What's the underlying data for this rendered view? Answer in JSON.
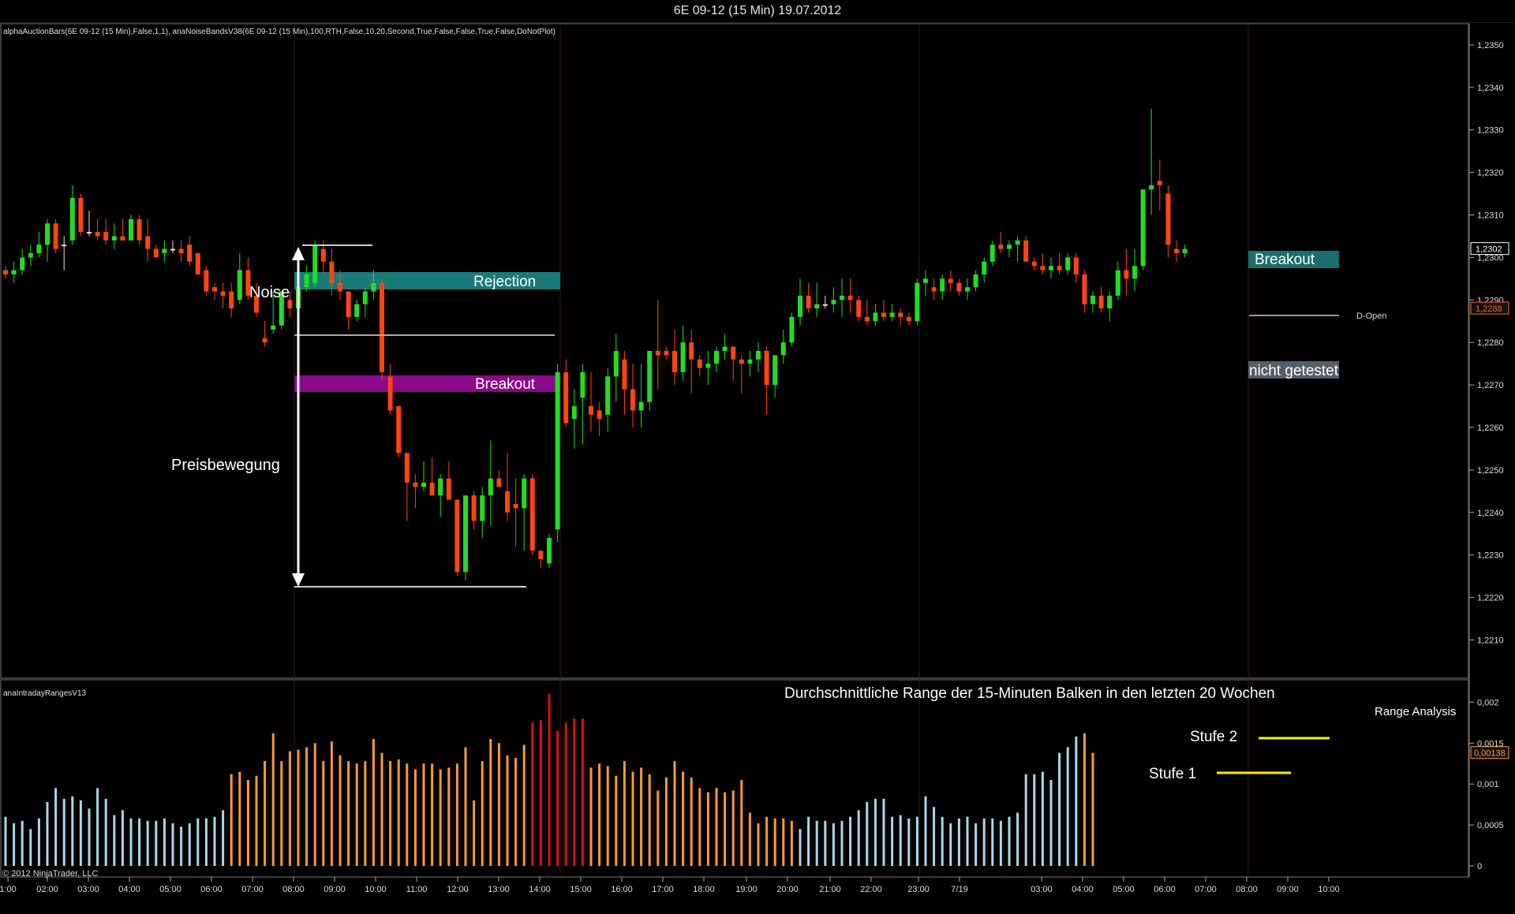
{
  "window": {
    "title": "6E 09-12 (15 Min)  19.07.2012"
  },
  "indicator_text": "alphaAuctionBars(6E 09-12 (15 Min),False,1,1), anaNoiseBandsV38(6E 09-12 (15 Min),100,RTH,False,10,20,Second,True,False,False,True,False,DoNotPlot)",
  "lower_panel_label": "anaIntradayRangesV13",
  "copyright": "© 2012 NinjaTrader, LLC",
  "annotations": {
    "noise": "Noise",
    "rejection": "Rejection",
    "breakout1": "Breakout",
    "preisbewegung": "Preisbewegung",
    "breakout2": "Breakout",
    "nicht_getestet": "nicht getestet",
    "d_open": "D-Open",
    "range_title": "Durchschnittliche Range der 15-Minuten Balken in den letzten 20 Wochen",
    "range_analysis": "Range Analysis",
    "stufe1": "Stufe 1",
    "stufe2": "Stufe 2"
  },
  "colors": {
    "up": "#22dd22",
    "down": "#ff4411",
    "neutral": "#ffddcc",
    "rejection_band": "#1a7a7a",
    "breakout_band": "#8a0a8a",
    "range_low": "#a8d8e8",
    "range_mid": "#ff9933",
    "range_high": "#dd1111",
    "stufe_line": "#ffee00",
    "breakout2_box": "#1a6e6e",
    "nicht_box": "#555e66"
  },
  "chart_data": [
    {
      "type": "candlestick",
      "title": "6E 09-12 (15 Min)  19.07.2012",
      "price_ticks": [
        "1,2350",
        "1,2340",
        "1,2330",
        "1,2320",
        "1,2310",
        "1,2300",
        "1,2290",
        "1,2280",
        "1,2270",
        "1,2260",
        "1,2250",
        "1,2240",
        "1,2230",
        "1,2220",
        "1,2210"
      ],
      "ylim": [
        1.2201,
        1.2355
      ],
      "price_labels": [
        {
          "value": 1.2302,
          "text": "1,2302"
        },
        {
          "value": 1.2288,
          "text": "1,2288"
        }
      ],
      "time_ticks": [
        "1:00",
        "02:00",
        "03:00",
        "04:00",
        "05:00",
        "06:00",
        "07:00",
        "08:00",
        "09:00",
        "10:00",
        "11:00",
        "12:00",
        "13:00",
        "14:00",
        "15:00",
        "16:00",
        "17:00",
        "18:00",
        "19:00",
        "20:00",
        "21:00",
        "22:00",
        "23:00",
        "7/19",
        "03:00",
        "04:00",
        "05:00",
        "06:00",
        "07:00",
        "08:00",
        "09:00",
        "10:00"
      ],
      "candles": [
        [
          1.2297,
          1.2298,
          1.2295,
          1.2296
        ],
        [
          1.2296,
          1.2299,
          1.2294,
          1.2297
        ],
        [
          1.2297,
          1.2302,
          1.2296,
          1.23
        ],
        [
          1.23,
          1.2303,
          1.2298,
          1.2301
        ],
        [
          1.2301,
          1.2306,
          1.23,
          1.2303
        ],
        [
          1.2303,
          1.2309,
          1.2299,
          1.2308
        ],
        [
          1.2308,
          1.2309,
          1.2301,
          1.2302
        ],
        [
          1.2303,
          1.2305,
          1.2297,
          1.2303
        ],
        [
          1.2304,
          1.2317,
          1.2303,
          1.2314
        ],
        [
          1.2314,
          1.2315,
          1.2305,
          1.2306
        ],
        [
          1.2306,
          1.2311,
          1.2305,
          1.2306
        ],
        [
          1.2306,
          1.2309,
          1.2304,
          1.2305
        ],
        [
          1.2306,
          1.2309,
          1.2303,
          1.2304
        ],
        [
          1.2304,
          1.2308,
          1.2302,
          1.2305
        ],
        [
          1.2305,
          1.2309,
          1.2304,
          1.2304
        ],
        [
          1.2304,
          1.231,
          1.2304,
          1.2309
        ],
        [
          1.2309,
          1.231,
          1.2303,
          1.2304
        ],
        [
          1.2305,
          1.2309,
          1.2299,
          1.2302
        ],
        [
          1.2302,
          1.2303,
          1.23,
          1.23
        ],
        [
          1.2301,
          1.2304,
          1.2299,
          1.2302
        ],
        [
          1.2302,
          1.2304,
          1.2301,
          1.2302
        ],
        [
          1.2302,
          1.2304,
          1.2299,
          1.2301
        ],
        [
          1.2303,
          1.2305,
          1.2298,
          1.2299
        ],
        [
          1.2301,
          1.2301,
          1.2296,
          1.2296
        ],
        [
          1.2297,
          1.2298,
          1.2291,
          1.2292
        ],
        [
          1.2293,
          1.2294,
          1.229,
          1.2292
        ],
        [
          1.2292,
          1.2294,
          1.2288,
          1.2291
        ],
        [
          1.2292,
          1.2294,
          1.2286,
          1.2288
        ],
        [
          1.229,
          1.2301,
          1.2289,
          1.2297
        ],
        [
          1.2297,
          1.23,
          1.229,
          1.2291
        ],
        [
          1.2291,
          1.2294,
          1.2286,
          1.2287
        ],
        [
          1.2281,
          1.2285,
          1.2279,
          1.228
        ],
        [
          1.2283,
          1.2292,
          1.2282,
          1.2284
        ],
        [
          1.2284,
          1.2292,
          1.2283,
          1.2292
        ],
        [
          1.229,
          1.2292,
          1.2286,
          1.2288
        ],
        [
          1.2288,
          1.2294,
          1.2287,
          1.2293
        ],
        [
          1.2293,
          1.2298,
          1.2292,
          1.2296
        ],
        [
          1.2294,
          1.2304,
          1.2293,
          1.2303
        ],
        [
          1.2302,
          1.2304,
          1.2296,
          1.2299
        ],
        [
          1.2299,
          1.2302,
          1.2291,
          1.2294
        ],
        [
          1.2294,
          1.2297,
          1.229,
          1.2292
        ],
        [
          1.2292,
          1.2292,
          1.2283,
          1.2286
        ],
        [
          1.2286,
          1.229,
          1.2285,
          1.2289
        ],
        [
          1.2289,
          1.2293,
          1.2286,
          1.2292
        ],
        [
          1.2292,
          1.2297,
          1.229,
          1.2294
        ],
        [
          1.2294,
          1.2295,
          1.2271,
          1.2273
        ],
        [
          1.2272,
          1.2275,
          1.2263,
          1.2264
        ],
        [
          1.2265,
          1.2265,
          1.2253,
          1.2254
        ],
        [
          1.2254,
          1.2253,
          1.2238,
          1.2247
        ],
        [
          1.2247,
          1.2249,
          1.2241,
          1.2246
        ],
        [
          1.2246,
          1.2252,
          1.2245,
          1.2247
        ],
        [
          1.2247,
          1.2253,
          1.2244,
          1.2244
        ],
        [
          1.2244,
          1.2249,
          1.2239,
          1.2248
        ],
        [
          1.2248,
          1.2252,
          1.2244,
          1.2243
        ],
        [
          1.2243,
          1.2243,
          1.2225,
          1.2226
        ],
        [
          1.2226,
          1.2244,
          1.2224,
          1.2244
        ],
        [
          1.2244,
          1.2245,
          1.2236,
          1.2238
        ],
        [
          1.2238,
          1.2246,
          1.2234,
          1.2244
        ],
        [
          1.2244,
          1.2257,
          1.2237,
          1.2248
        ],
        [
          1.2248,
          1.225,
          1.2246,
          1.2246
        ],
        [
          1.2245,
          1.2254,
          1.2238,
          1.224
        ],
        [
          1.2242,
          1.2248,
          1.2232,
          1.2241
        ],
        [
          1.2241,
          1.2249,
          1.2231,
          1.2248
        ],
        [
          1.2248,
          1.2249,
          1.223,
          1.2231
        ],
        [
          1.2231,
          1.2231,
          1.2227,
          1.2229
        ],
        [
          1.2228,
          1.2235,
          1.2227,
          1.2234
        ],
        [
          1.2236,
          1.2275,
          1.2233,
          1.2273
        ],
        [
          1.2273,
          1.2276,
          1.226,
          1.2261
        ],
        [
          1.2262,
          1.2269,
          1.2255,
          1.2265
        ],
        [
          1.2267,
          1.2275,
          1.2256,
          1.2273
        ],
        [
          1.2265,
          1.2273,
          1.2259,
          1.2263
        ],
        [
          1.2264,
          1.2266,
          1.2258,
          1.2262
        ],
        [
          1.2263,
          1.2274,
          1.2259,
          1.2272
        ],
        [
          1.2272,
          1.2282,
          1.2266,
          1.2278
        ],
        [
          1.2276,
          1.2278,
          1.2263,
          1.2269
        ],
        [
          1.2269,
          1.2275,
          1.226,
          1.2264
        ],
        [
          1.2264,
          1.2275,
          1.226,
          1.2266
        ],
        [
          1.2266,
          1.2278,
          1.2264,
          1.2278
        ],
        [
          1.2278,
          1.229,
          1.2269,
          1.2277
        ],
        [
          1.2278,
          1.2279,
          1.2276,
          1.2277
        ],
        [
          1.2278,
          1.2283,
          1.227,
          1.2273
        ],
        [
          1.2273,
          1.2284,
          1.2271,
          1.228
        ],
        [
          1.228,
          1.2283,
          1.2268,
          1.2276
        ],
        [
          1.2276,
          1.2277,
          1.2272,
          1.2274
        ],
        [
          1.2274,
          1.2278,
          1.227,
          1.2275
        ],
        [
          1.2275,
          1.2279,
          1.2273,
          1.2278
        ],
        [
          1.2278,
          1.2282,
          1.2276,
          1.2279
        ],
        [
          1.2279,
          1.2279,
          1.2271,
          1.2276
        ],
        [
          1.2276,
          1.2277,
          1.2268,
          1.2275
        ],
        [
          1.2275,
          1.2278,
          1.2272,
          1.2276
        ],
        [
          1.2276,
          1.228,
          1.2273,
          1.2278
        ],
        [
          1.2278,
          1.2279,
          1.2263,
          1.227
        ],
        [
          1.227,
          1.2277,
          1.2267,
          1.2277
        ],
        [
          1.2277,
          1.2283,
          1.2275,
          1.228
        ],
        [
          1.228,
          1.2287,
          1.2279,
          1.2286
        ],
        [
          1.2286,
          1.2295,
          1.2284,
          1.2291
        ],
        [
          1.2291,
          1.2294,
          1.2287,
          1.2288
        ],
        [
          1.2288,
          1.2294,
          1.2286,
          1.2289
        ],
        [
          1.2289,
          1.2291,
          1.2288,
          1.2289
        ],
        [
          1.2289,
          1.2293,
          1.2287,
          1.229
        ],
        [
          1.229,
          1.2295,
          1.2286,
          1.2291
        ],
        [
          1.2291,
          1.2295,
          1.2287,
          1.229
        ],
        [
          1.229,
          1.2291,
          1.2285,
          1.2286
        ],
        [
          1.2286,
          1.229,
          1.2284,
          1.2285
        ],
        [
          1.2285,
          1.2289,
          1.2284,
          1.2287
        ],
        [
          1.2287,
          1.229,
          1.2285,
          1.2286
        ],
        [
          1.2286,
          1.2289,
          1.2285,
          1.2287
        ],
        [
          1.2287,
          1.2288,
          1.2284,
          1.2286
        ],
        [
          1.2286,
          1.2287,
          1.2284,
          1.2285
        ],
        [
          1.2285,
          1.2295,
          1.2284,
          1.2294
        ],
        [
          1.2294,
          1.2297,
          1.2291,
          1.2295
        ],
        [
          1.2293,
          1.2295,
          1.229,
          1.2292
        ],
        [
          1.2292,
          1.2296,
          1.229,
          1.2295
        ],
        [
          1.2295,
          1.2297,
          1.2292,
          1.2294
        ],
        [
          1.2294,
          1.2295,
          1.2291,
          1.2292
        ],
        [
          1.2292,
          1.2295,
          1.229,
          1.2293
        ],
        [
          1.2293,
          1.2297,
          1.2292,
          1.2296
        ],
        [
          1.2296,
          1.23,
          1.2294,
          1.2299
        ],
        [
          1.2299,
          1.2304,
          1.2298,
          1.2303
        ],
        [
          1.2303,
          1.2306,
          1.2301,
          1.2302
        ],
        [
          1.2302,
          1.2304,
          1.23,
          1.2303
        ],
        [
          1.2303,
          1.2305,
          1.2299,
          1.2304
        ],
        [
          1.2304,
          1.2305,
          1.2299,
          1.2299
        ],
        [
          1.2299,
          1.23,
          1.2297,
          1.2298
        ],
        [
          1.2298,
          1.2301,
          1.2296,
          1.2297
        ],
        [
          1.2297,
          1.23,
          1.2295,
          1.2298
        ],
        [
          1.2298,
          1.2301,
          1.2296,
          1.2297
        ],
        [
          1.2297,
          1.2301,
          1.2296,
          1.23
        ],
        [
          1.23,
          1.2301,
          1.2294,
          1.2296
        ],
        [
          1.2296,
          1.2297,
          1.2287,
          1.2289
        ],
        [
          1.2289,
          1.2292,
          1.2287,
          1.2291
        ],
        [
          1.2291,
          1.2293,
          1.2287,
          1.2288
        ],
        [
          1.2288,
          1.2292,
          1.2285,
          1.2291
        ],
        [
          1.2291,
          1.2299,
          1.229,
          1.2297
        ],
        [
          1.2297,
          1.2302,
          1.2291,
          1.2295
        ],
        [
          1.2295,
          1.2302,
          1.2292,
          1.2298
        ],
        [
          1.2298,
          1.2316,
          1.2297,
          1.2316
        ],
        [
          1.2316,
          1.2335,
          1.231,
          1.2317
        ],
        [
          1.2318,
          1.2323,
          1.2311,
          1.2317
        ],
        [
          1.2315,
          1.2317,
          1.23,
          1.2303
        ],
        [
          1.2302,
          1.2304,
          1.2299,
          1.2301
        ],
        [
          1.2301,
          1.2303,
          1.23,
          1.2302
        ]
      ],
      "lines": [
        {
          "from": 1.2305,
          "to": 1.2305,
          "label": ""
        },
        {
          "value": 1.2284,
          "label": ""
        },
        {
          "value": 1.2225,
          "label": ""
        },
        {
          "value": 1.2288,
          "label": "D-Open"
        }
      ]
    },
    {
      "type": "bar",
      "title": "anaIntradayRangesV13",
      "ylabel": "",
      "yticks": [
        "0,002",
        "0,0015",
        "0,001",
        "0,0005",
        "0"
      ],
      "ylim": [
        0,
        0.0021
      ],
      "current_label": "0,00138",
      "values": [
        0.0006,
        0.00052,
        0.00055,
        0.00045,
        0.00058,
        0.00078,
        0.00095,
        0.00082,
        0.00085,
        0.0008,
        0.0007,
        0.00095,
        0.00082,
        0.00062,
        0.00068,
        0.00058,
        0.00058,
        0.00055,
        0.00055,
        0.00058,
        0.00052,
        0.00048,
        0.00052,
        0.00058,
        0.00058,
        0.0006,
        0.00068,
        0.00112,
        0.00115,
        0.00105,
        0.0011,
        0.00128,
        0.00162,
        0.00128,
        0.0014,
        0.00142,
        0.00145,
        0.0015,
        0.00128,
        0.00152,
        0.00135,
        0.00128,
        0.00125,
        0.00128,
        0.00155,
        0.00138,
        0.00128,
        0.0013,
        0.00125,
        0.00118,
        0.00125,
        0.00125,
        0.00118,
        0.0012,
        0.00125,
        0.00145,
        0.0008,
        0.00128,
        0.00155,
        0.0015,
        0.00135,
        0.00132,
        0.00148,
        0.00175,
        0.00178,
        0.0021,
        0.00165,
        0.00175,
        0.0018,
        0.0018,
        0.0012,
        0.00125,
        0.00122,
        0.0011,
        0.00128,
        0.00115,
        0.0012,
        0.00112,
        0.00092,
        0.00108,
        0.00128,
        0.00115,
        0.00108,
        0.00095,
        0.0009,
        0.00095,
        0.0009,
        0.00092,
        0.00105,
        0.00065,
        0.00052,
        0.0006,
        0.00058,
        0.00058,
        0.00055,
        0.00045,
        0.0006,
        0.00055,
        0.00055,
        0.00052,
        0.00055,
        0.0006,
        0.00068,
        0.00078,
        0.00082,
        0.00082,
        0.0006,
        0.00062,
        0.00058,
        0.0006,
        0.00085,
        0.00072,
        0.0006,
        0.00052,
        0.00058,
        0.0006,
        0.00052,
        0.00058,
        0.00058,
        0.00055,
        0.0006,
        0.00065,
        0.00112,
        0.00112,
        0.00115,
        0.00105,
        0.00138,
        0.00145,
        0.00158,
        0.00162,
        0.00138
      ]
    }
  ]
}
